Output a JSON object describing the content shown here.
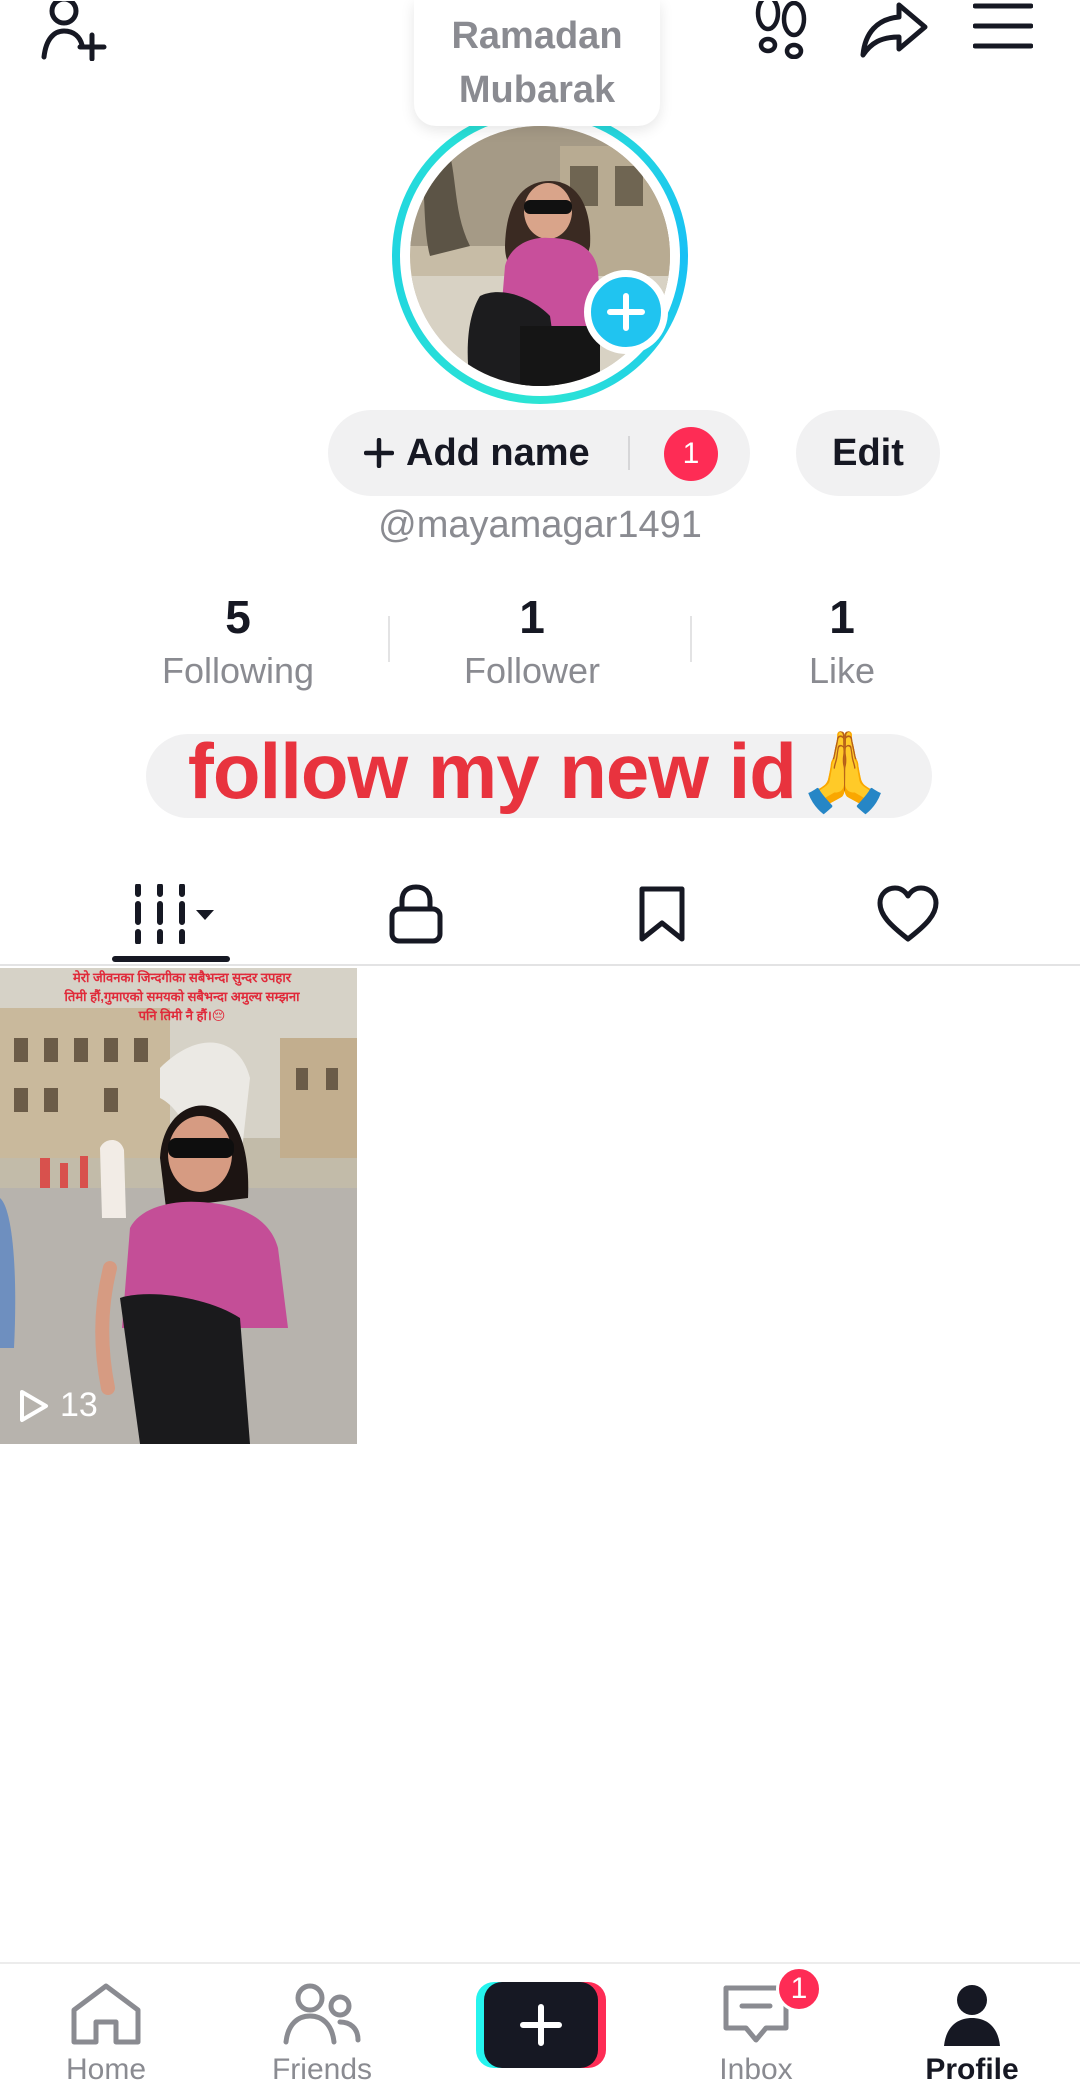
{
  "note": {
    "text": "Ramadan\nMubarak"
  },
  "profile": {
    "add_name_label": "Add name",
    "add_name_badge": "1",
    "edit_label": "Edit",
    "username": "@mayamagar1491"
  },
  "stats": [
    {
      "value": "5",
      "label": "Following"
    },
    {
      "value": "1",
      "label": "Follower"
    },
    {
      "value": "1",
      "label": "Like"
    }
  ],
  "bio": {
    "overlay_text": "follow my new id",
    "emoji": "🙏"
  },
  "tabs": [
    {
      "icon": "grid-icon",
      "active": true
    },
    {
      "icon": "lock-icon",
      "active": false
    },
    {
      "icon": "bookmark-icon",
      "active": false
    },
    {
      "icon": "heart-icon",
      "active": false
    }
  ],
  "videos": [
    {
      "views": "13",
      "caption": "मेरो जीवनका जिन्दगीका सबैभन्दा सुन्दर उपहार तिमी हौं,गुमाएको समयको सबैभन्दा अमुल्य सम्झना पनि तिमी नै हौं।😔"
    }
  ],
  "bottom_nav": {
    "home_label": "Home",
    "friends_label": "Friends",
    "inbox_label": "Inbox",
    "inbox_badge": "1",
    "profile_label": "Profile"
  },
  "colors": {
    "accent": "#fe2c55",
    "cyan": "#25f4ee",
    "text": "#161823",
    "muted": "#8a8b91",
    "overlay_red": "#e8333e"
  }
}
